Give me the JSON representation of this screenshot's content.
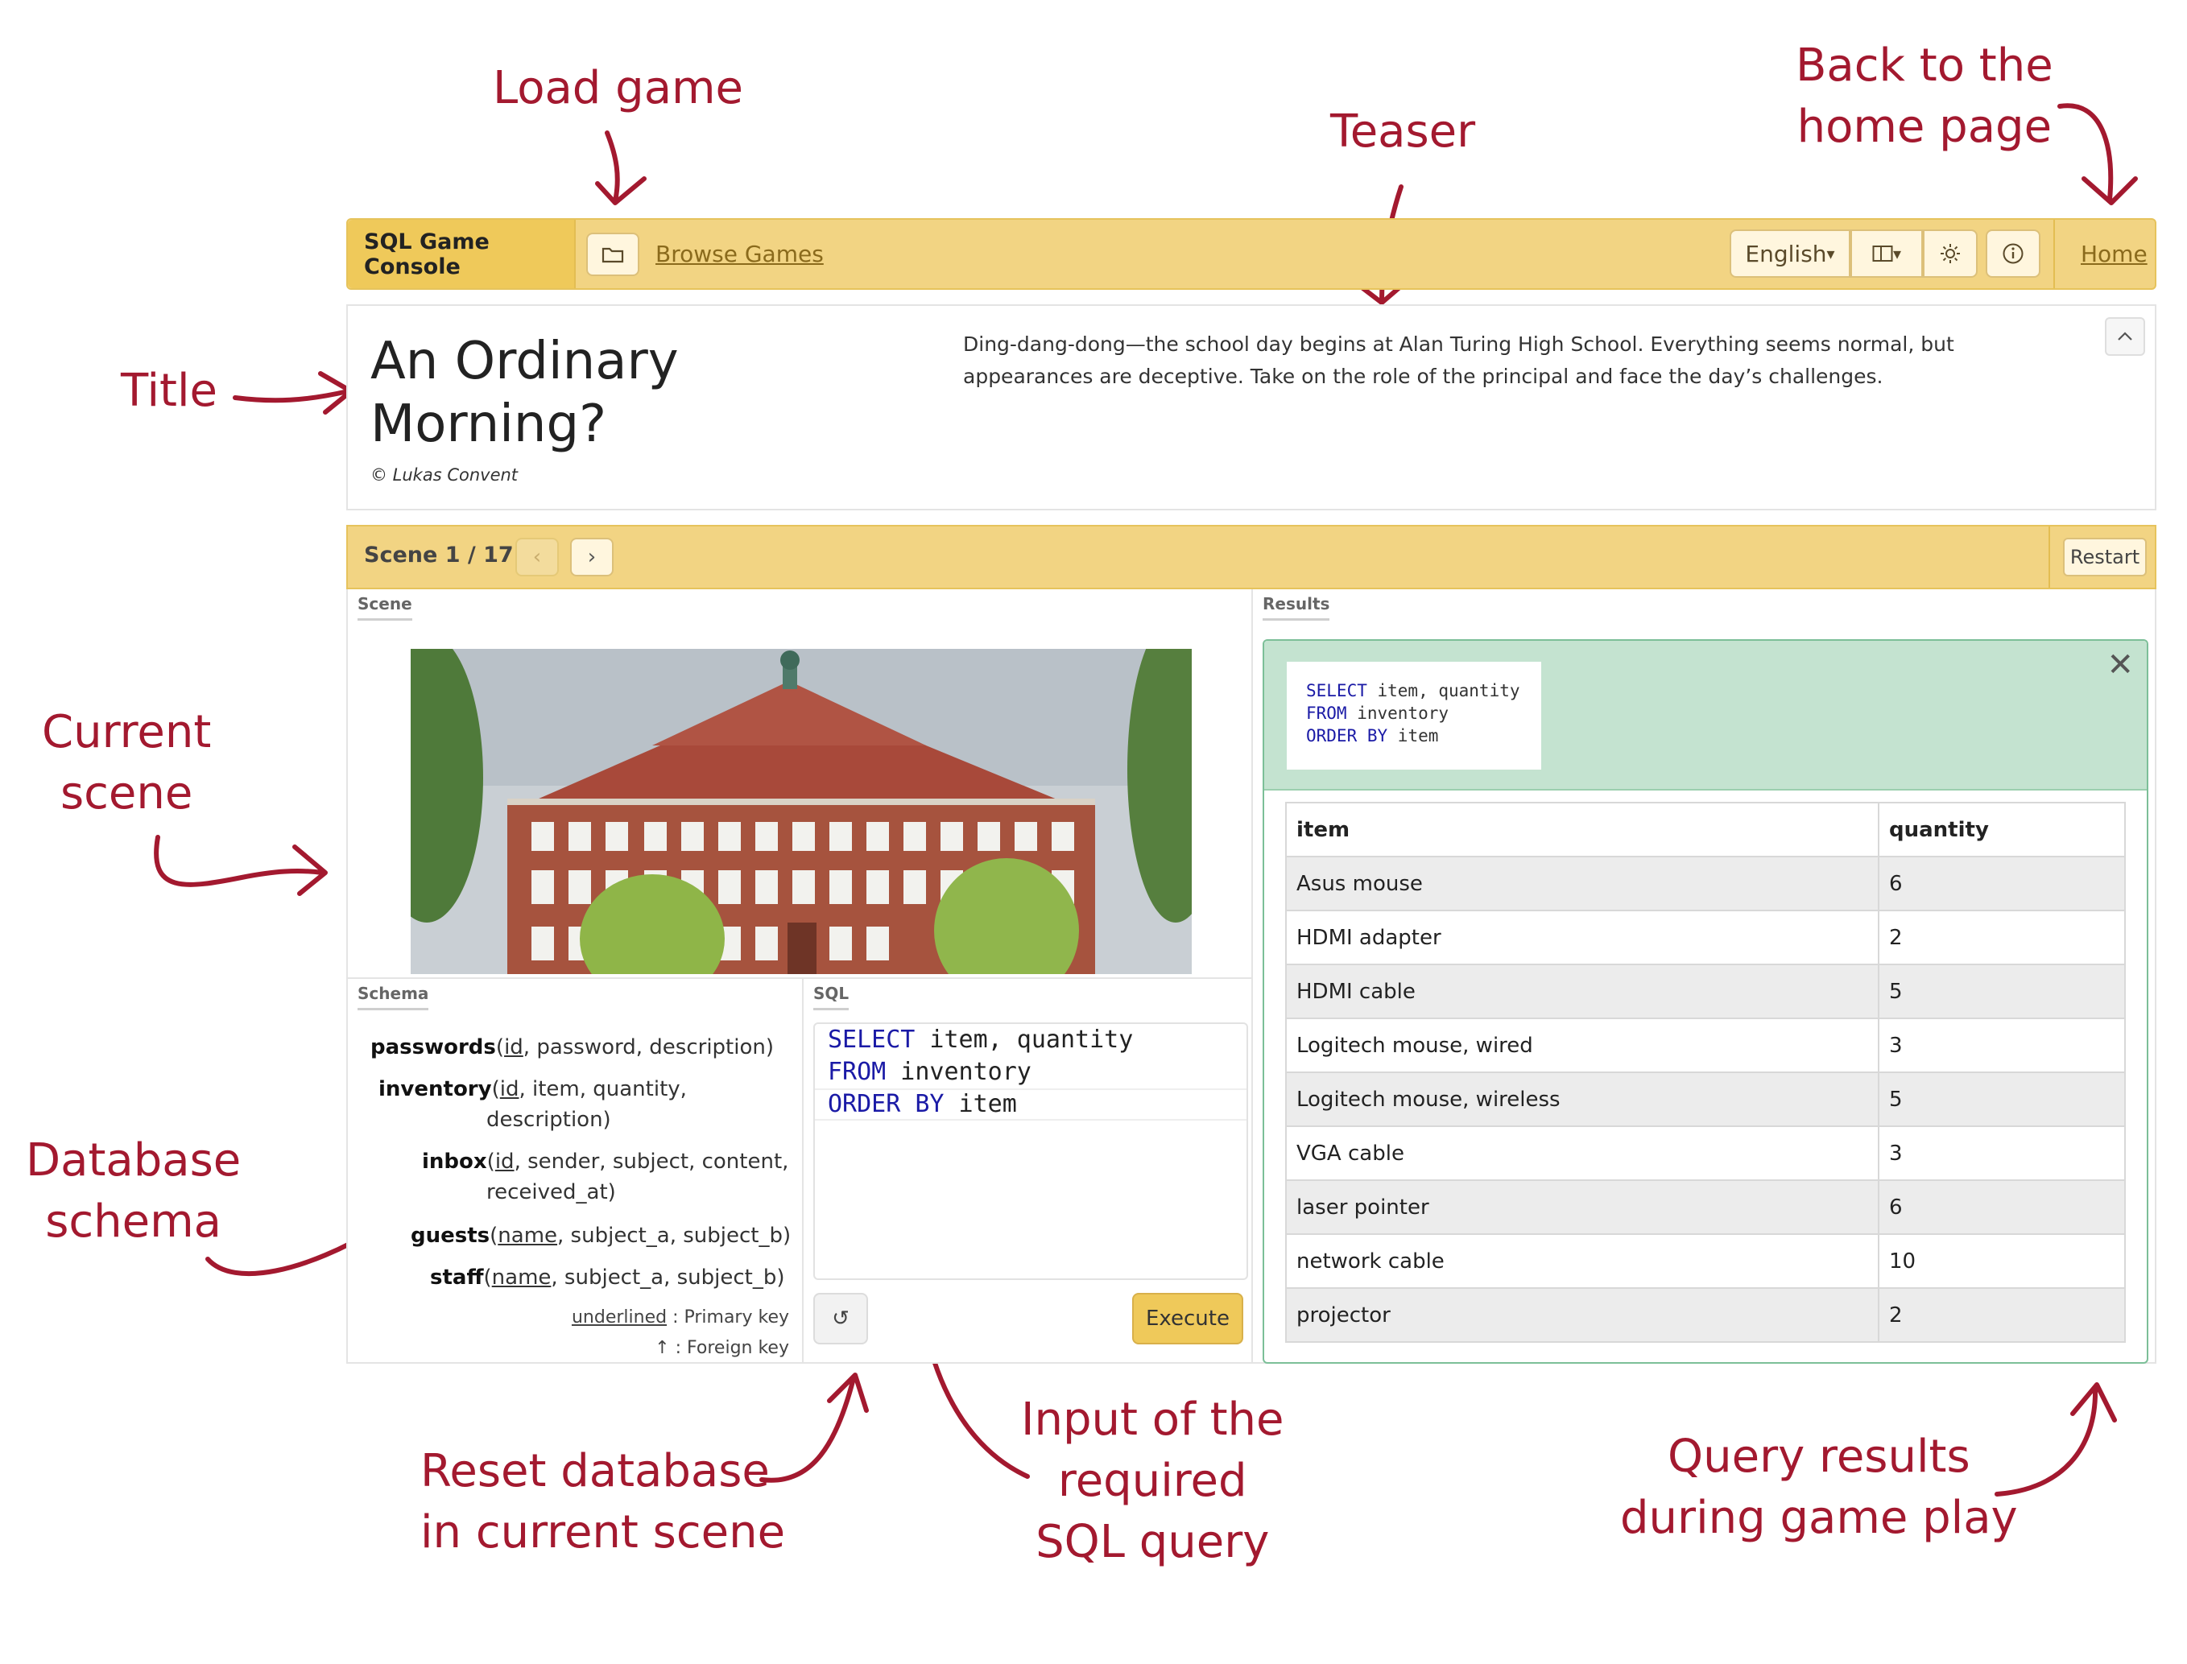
{
  "annotations": {
    "load_game": "Load game",
    "teaser": "Teaser",
    "home_line1": "Back to the",
    "home_line2": "home page",
    "title": "Title",
    "current_scene_line1": "Current",
    "current_scene_line2": "scene",
    "database_schema_line1": "Database",
    "database_schema_line2": "schema",
    "reset_line1": "Reset database",
    "reset_line2": "in current scene",
    "input_line1": "Input of the",
    "input_line2": "required",
    "input_line3": "SQL query",
    "results_line1": "Query results",
    "results_line2": "during game play"
  },
  "navbar": {
    "brand": "SQL Game Console",
    "browse_games": "Browse Games",
    "language": "English",
    "home": "Home",
    "icons": [
      "folder-icon",
      "layout-icon",
      "sun-icon",
      "info-icon"
    ]
  },
  "game": {
    "title_line1": "An Ordinary",
    "title_line2": "Morning?",
    "author": "© Lukas Convent",
    "teaser": "Ding-dang-dong—the school day begins at Alan Turing High School. Everything seems normal, but appearances are deceptive. Take on the role of the principal and face the day’s challenges."
  },
  "scene_bar": {
    "label": "Scene 1 / 17",
    "prev": "‹",
    "next": "›",
    "restart": "Restart"
  },
  "panels": {
    "scene_tab": "Scene",
    "schema_tab": "Schema",
    "sql_tab": "SQL",
    "results_tab": "Results"
  },
  "schema": {
    "passwords_name": "passwords",
    "passwords_key": "id",
    "passwords_rest": ", password, description)",
    "inventory_name": "inventory",
    "inventory_key": "id",
    "inventory_rest": ", item, quantity,",
    "inventory_rest2": "description)",
    "inbox_name": "inbox",
    "inbox_key": "id",
    "inbox_rest": ", sender, subject, content,",
    "inbox_rest2": "received_at)",
    "guests_name": "guests",
    "guests_key": "name",
    "guests_rest": ", subject_a, subject_b)",
    "staff_name": "staff",
    "staff_key": "name",
    "staff_rest": ", subject_a, subject_b)",
    "legend_primary_word": "underlined",
    "legend_primary": " : Primary key",
    "legend_foreign": "↑ : Foreign key"
  },
  "sql": {
    "kw1": "SELECT",
    "rest1": " item, quantity",
    "kw2": "FROM",
    "rest2": " inventory",
    "kw3": "ORDER BY",
    "rest3": " item",
    "reset_icon": "↺",
    "execute": "Execute"
  },
  "results": {
    "query_kw1": "SELECT",
    "query_rest1": " item, quantity",
    "query_kw2": "FROM",
    "query_rest2": " inventory",
    "query_kw3": "ORDER BY",
    "query_rest3": " item",
    "close": "✕",
    "columns": [
      "item",
      "quantity"
    ],
    "rows": [
      [
        "Asus mouse",
        "6"
      ],
      [
        "HDMI adapter",
        "2"
      ],
      [
        "HDMI cable",
        "5"
      ],
      [
        "Logitech mouse, wired",
        "3"
      ],
      [
        "Logitech mouse, wireless",
        "5"
      ],
      [
        "VGA cable",
        "3"
      ],
      [
        "laser pointer",
        "6"
      ],
      [
        "network cable",
        "10"
      ],
      [
        "projector",
        "2"
      ]
    ]
  },
  "colors": {
    "annotation": "#a3192f",
    "navbar": "#f2d483",
    "brand": "#efc95a",
    "result_header": "#c4e3d0"
  }
}
